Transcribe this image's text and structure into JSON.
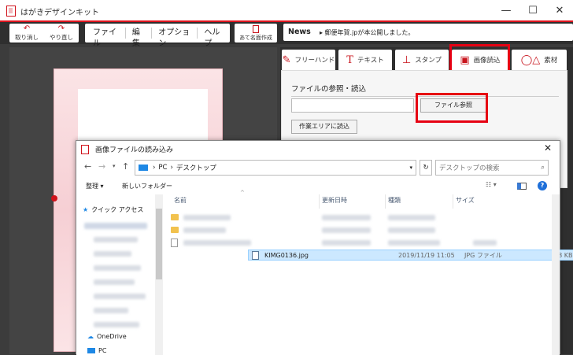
{
  "app": {
    "title": "はがきデザインキット"
  },
  "window_controls": {
    "minimize": "—",
    "maximize": "☐",
    "close": "✕"
  },
  "toolbar": {
    "undo_label": "取り消し",
    "redo_label": "やり直し",
    "menus": [
      "ファイル",
      "編集",
      "オプション",
      "ヘルプ"
    ],
    "address_label": "あて名面作成"
  },
  "news": {
    "label": "News",
    "text": "▸ 郵便年賀.jpが本公開しました。"
  },
  "tabs": [
    {
      "label": "フリーハンド",
      "icon": "pencil-icon"
    },
    {
      "label": "テキスト",
      "icon": "text-icon"
    },
    {
      "label": "スタンプ",
      "icon": "stamp-icon"
    },
    {
      "label": "画像読込",
      "icon": "image-icon"
    },
    {
      "label": "素材",
      "icon": "shapes-icon"
    }
  ],
  "panel": {
    "heading": "ファイルの参照・読込",
    "browse_button": "ファイル参照",
    "load_button": "作業エリアに読込"
  },
  "dialog": {
    "title": "画像ファイルの読み込み",
    "breadcrumb": [
      "PC",
      "デスクトップ"
    ],
    "search_placeholder": "デスクトップの検索",
    "organize": "整理 ▾",
    "new_folder": "新しいフォルダー",
    "nav": {
      "quick_access": "クイック アクセス",
      "onedrive": "OneDrive",
      "pc": "PC"
    },
    "columns": [
      "名前",
      "更新日時",
      "種類",
      "サイズ"
    ],
    "selected_file": {
      "name": "KIMG0136.jpg",
      "date": "2019/11/19 11:05",
      "type": "JPG ファイル",
      "size": "58 KB"
    }
  },
  "colors": {
    "accent": "#e60012",
    "selection": "#cce8ff"
  }
}
